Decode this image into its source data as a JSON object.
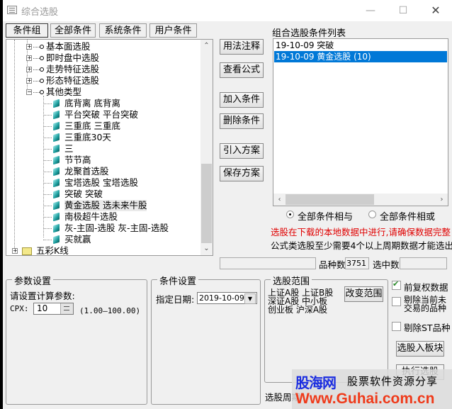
{
  "window": {
    "title": "综合选股",
    "controls": {
      "minimize": "—",
      "maximize": "☐",
      "close": "✕"
    }
  },
  "tabs": [
    {
      "label": "条件组",
      "active": true
    },
    {
      "label": "全部条件",
      "active": false
    },
    {
      "label": "系统条件",
      "active": false
    },
    {
      "label": "用户条件",
      "active": false
    }
  ],
  "tree": {
    "categories": [
      {
        "label": "基本面选股",
        "expanded": false,
        "icon": "key-icon"
      },
      {
        "label": "即时盘中选股",
        "expanded": false,
        "icon": "key-icon"
      },
      {
        "label": "走势特征选股",
        "expanded": false,
        "icon": "key-icon"
      },
      {
        "label": "形态特征选股",
        "expanded": false,
        "icon": "key-icon"
      },
      {
        "label": "其他类型",
        "expanded": true,
        "icon": "key-icon"
      }
    ],
    "children": [
      "底背离  底背离",
      "平台突破  平台突破",
      "三重底  三重底",
      "三重底30天",
      "三",
      "节节高",
      "龙聚首选股",
      "宝塔选股  宝塔选股",
      "突破  突破",
      "黄金选股  选未来牛股",
      "南极超牛选股",
      "灰-主固-选股  灰-主固-选股",
      "买就赢"
    ],
    "hovered_child": "黄金选股  选未来牛股",
    "folder": {
      "label": "五彩K线",
      "expanded": false
    }
  },
  "buttons": {
    "usage_notes": "用法注释",
    "view_formula": "查看公式",
    "add_condition": "加入条件",
    "delete_condition": "删除条件",
    "import_plan": "引入方案",
    "save_plan": "保存方案",
    "change_range": "改变范围",
    "add_to_block": "选股入板块",
    "execute": "执行选股"
  },
  "condition_list": {
    "title": "组合选股条件列表",
    "items": [
      {
        "label": "19-10-09 突破",
        "selected": false
      },
      {
        "label": "19-10-09 黄金选股 (10)",
        "selected": true
      }
    ]
  },
  "logic": {
    "and_label": "全部条件相与",
    "or_label": "全部条件相或",
    "selected": "and"
  },
  "notices": {
    "warning": "选股在下载的本地数据中进行,请确保数据完整",
    "info": "公式类选股至少需要4个以上周期数据才能选出"
  },
  "stats": {
    "count_label": "品种数",
    "count_value": "3751",
    "selected_label": "选中数",
    "selected_value": ""
  },
  "params": {
    "group_title": "参数设置",
    "prompt": "请设置计算参数:",
    "name": "CPX:",
    "value": "10",
    "range": "(1.00—100.00)"
  },
  "condition_settings": {
    "group_title": "条件设置",
    "date_label": "指定日期:",
    "date_value": "2019-10-09"
  },
  "range": {
    "group_title": "选股范围",
    "lines": [
      "上证A股 上证B股",
      "深证A股 中小板",
      "创业板 沪深A股"
    ]
  },
  "options": [
    {
      "label": "前复权数据",
      "checked": true
    },
    {
      "label": "剔除当前未交易的品种",
      "checked": false
    },
    {
      "label": "剔除ST品种",
      "checked": false
    }
  ],
  "period_label": "选股周期",
  "watermark": {
    "brand": "股海网",
    "slogan": "股票软件资源分享",
    "url": "Www.Guhai.com.cn"
  }
}
